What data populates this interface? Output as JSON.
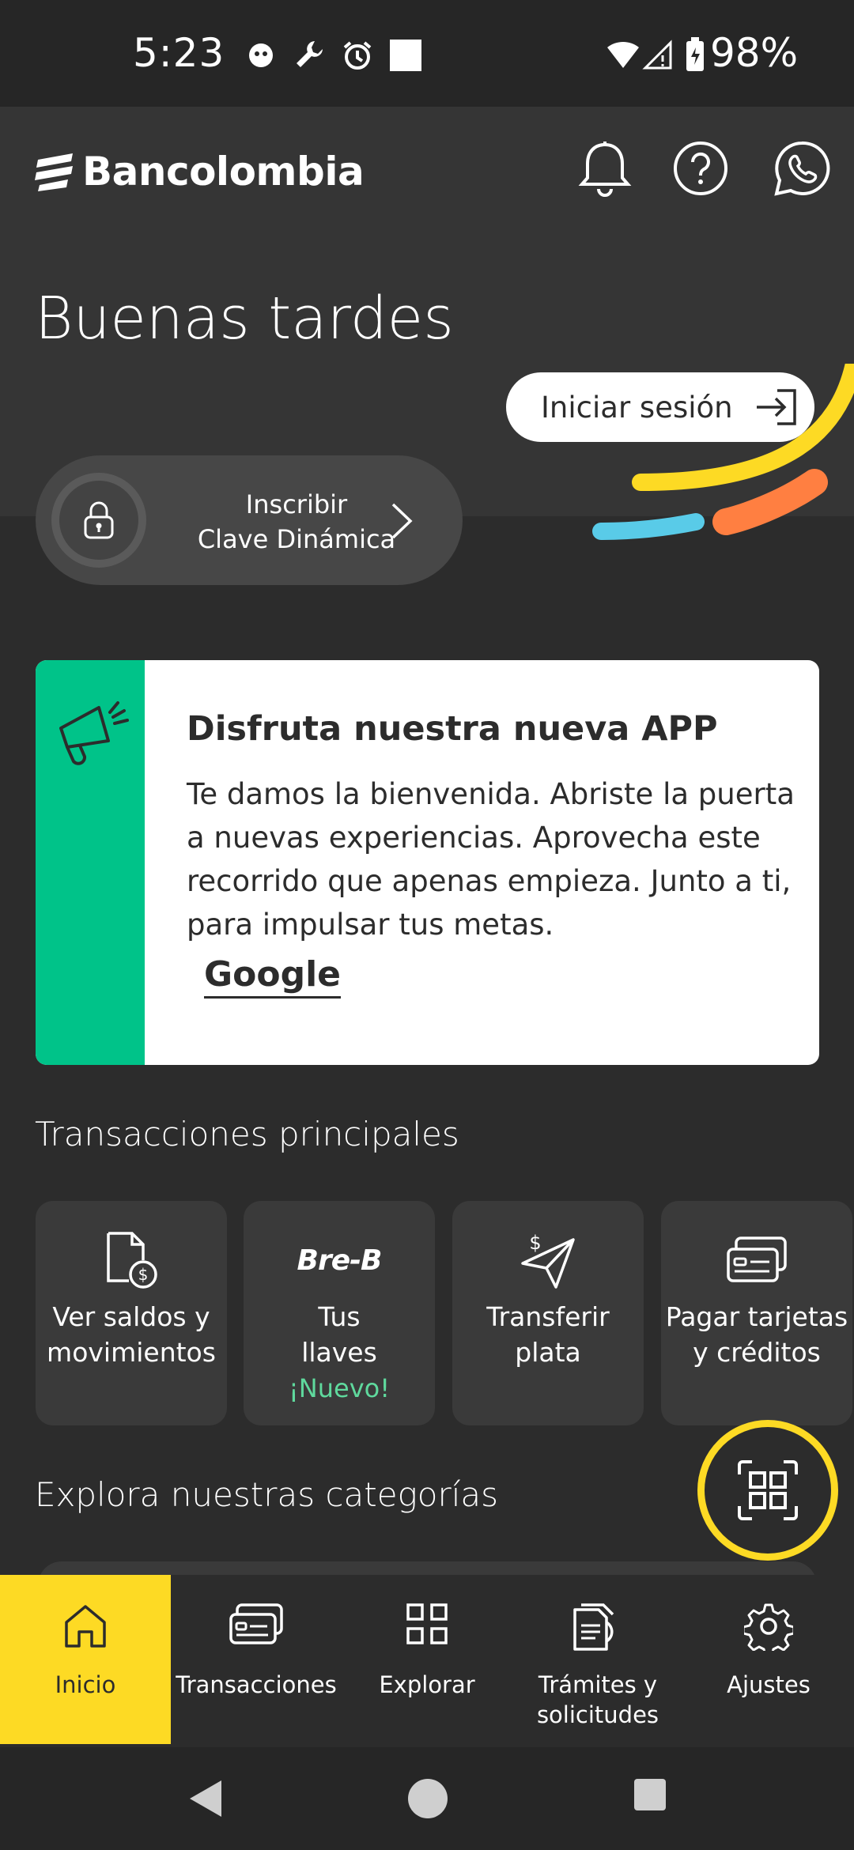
{
  "status_bar": {
    "time": "5:23",
    "battery": "98%"
  },
  "header": {
    "brand": "Bancolombia",
    "icons": [
      "bell-icon",
      "help-icon",
      "whatsapp-icon"
    ]
  },
  "greeting": "Buenas tardes",
  "login_button": {
    "label": "Iniciar sesión",
    "icon": "login-arrow-icon"
  },
  "enroll": {
    "line1": "Inscribir",
    "line2": "Clave Dinámica"
  },
  "banner": {
    "title": "Disfruta nuestra nueva APP",
    "body": "Te damos la bienvenida. Abriste la puerta a nuevas experiencias. Aprovecha este recorrido que apenas empieza. Junto a ti, para impulsar tus metas.",
    "link": "Google",
    "accent": "#00c389"
  },
  "transactions": {
    "title": "Transacciones principales",
    "items": [
      {
        "line1": "Ver saldos y",
        "line2": "movimientos",
        "icon": "document-money-icon"
      },
      {
        "line1": "Tus",
        "line2": "llaves",
        "badge": "¡Nuevo!",
        "icon_text": "Bre-B"
      },
      {
        "line1": "Transferir",
        "line2": "plata",
        "icon": "send-money-icon"
      },
      {
        "line1": "Pagar tarjetas",
        "line2": "y créditos",
        "icon": "cards-icon"
      }
    ]
  },
  "explore_title": "Explora nuestras categorías",
  "bottom_nav": [
    {
      "line1": "Inicio",
      "line2": "",
      "icon": "home-icon",
      "active": true
    },
    {
      "line1": "Transacciones",
      "line2": "",
      "icon": "transactions-icon"
    },
    {
      "line1": "Explorar",
      "line2": "",
      "icon": "grid-icon"
    },
    {
      "line1": "Trámites y",
      "line2": "solicitudes",
      "icon": "document-icon"
    },
    {
      "line1": "Ajustes",
      "line2": "",
      "icon": "gear-icon"
    }
  ],
  "colors": {
    "brand_yellow": "#fdda24",
    "background": "#2c2c2c",
    "new_badge": "#5fd99d"
  }
}
